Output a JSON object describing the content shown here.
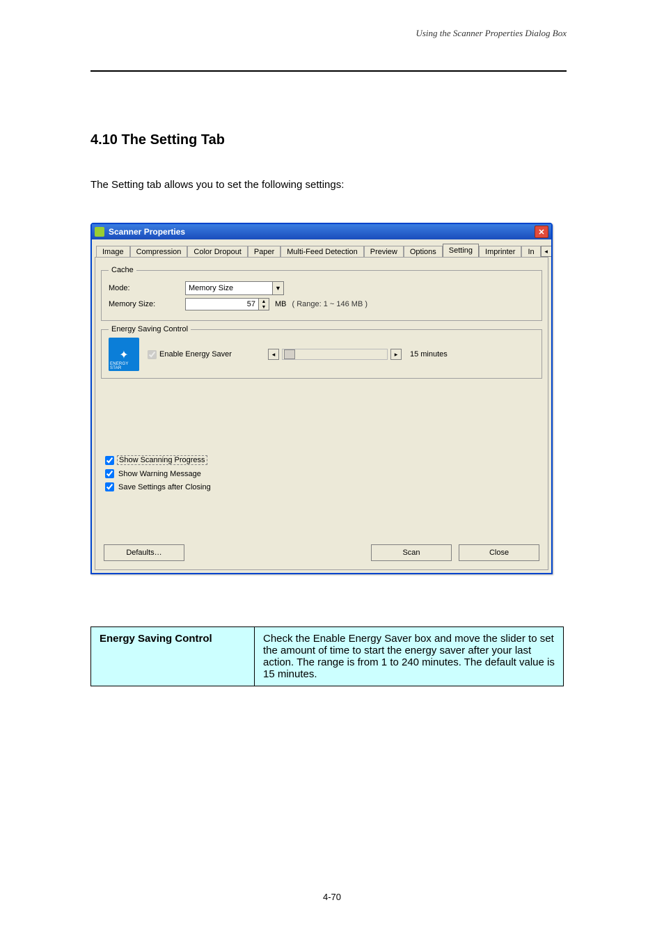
{
  "doc": {
    "header": "Using the Scanner Properties Dialog Box",
    "section_title": "4.10 The Setting Tab",
    "section_subtext": "The Setting tab allows you to set the following settings:",
    "page_number": "4-70"
  },
  "dialog": {
    "title": "Scanner Properties",
    "tabs": [
      "Image",
      "Compression",
      "Color Dropout",
      "Paper",
      "Multi-Feed Detection",
      "Preview",
      "Options",
      "Setting",
      "Imprinter",
      "In"
    ],
    "active_tab": "Setting",
    "cache": {
      "legend": "Cache",
      "mode_label": "Mode:",
      "mode_value": "Memory Size",
      "memsize_label": "Memory Size:",
      "memsize_value": "57",
      "memsize_unit": "MB",
      "memsize_range": "( Range: 1 ~ 146 MB )"
    },
    "energy": {
      "legend": "Energy Saving Control",
      "enable_label": "Enable Energy Saver",
      "enable_checked": true,
      "minutes_label": "15 minutes"
    },
    "options": {
      "show_progress": {
        "label": "Show Scanning Progress",
        "checked": true
      },
      "show_warning": {
        "label": "Show Warning Message",
        "checked": true
      },
      "save_settings": {
        "label": "Save Settings after Closing",
        "checked": true
      }
    },
    "buttons": {
      "defaults": "Defaults…",
      "scan": "Scan",
      "close": "Close"
    }
  },
  "table": {
    "row1_key": "Energy Saving Control",
    "row1_val": "Check the Enable Energy Saver box and move the slider to set the amount of time to start the energy saver after your last action. The range is from 1 to 240 minutes. The default value is 15 minutes."
  }
}
